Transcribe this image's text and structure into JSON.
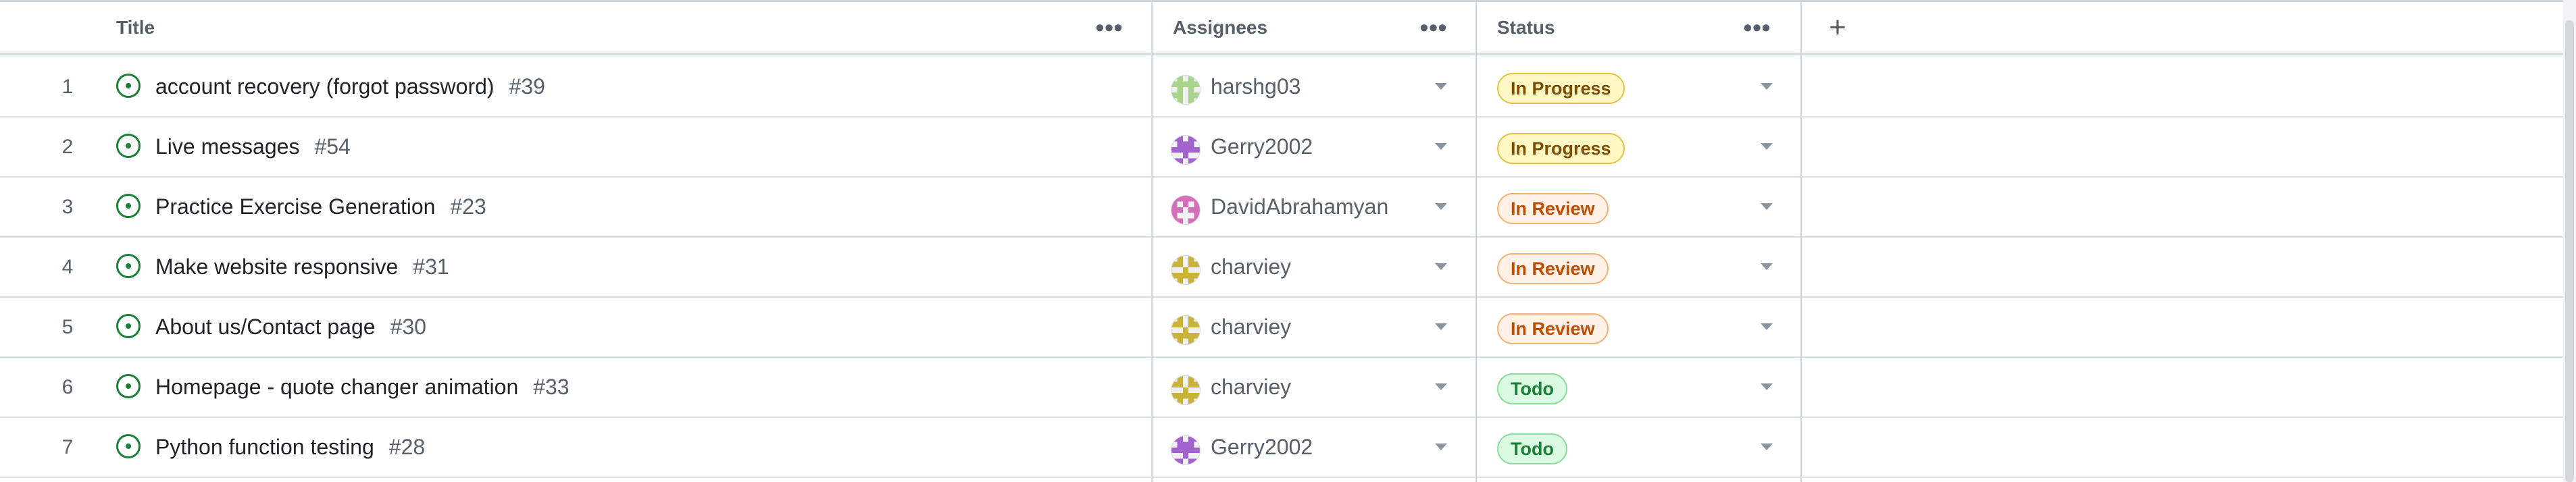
{
  "header": {
    "title_label": "Title",
    "assignees_label": "Assignees",
    "status_label": "Status",
    "menu_glyph": "•••",
    "add_column_glyph": "+"
  },
  "colors": {
    "in_progress": {
      "bg": "#fff8c5",
      "border": "#e3c24a",
      "text": "#7d4e00"
    },
    "in_review": {
      "bg": "#fff1e5",
      "border": "#f2b27a",
      "text": "#bc4c00"
    },
    "todo": {
      "bg": "#dafbe1",
      "border": "#8ddb9f",
      "text": "#1a7f37"
    },
    "open_issue_icon": "#1a7f37"
  },
  "rows": [
    {
      "num": "1",
      "title": "account recovery (forgot password)",
      "issue": "#39",
      "assignee": "harshg03",
      "avatar": "harshg03-avatar",
      "status": "In Progress",
      "status_key": "in_progress"
    },
    {
      "num": "2",
      "title": "Live messages",
      "issue": "#54",
      "assignee": "Gerry2002",
      "avatar": "gerry2002-avatar",
      "status": "In Progress",
      "status_key": "in_progress"
    },
    {
      "num": "3",
      "title": "Practice Exercise Generation",
      "issue": "#23",
      "assignee": "DavidAbrahamyan",
      "avatar": "davidabrahamyan-avatar",
      "status": "In Review",
      "status_key": "in_review"
    },
    {
      "num": "4",
      "title": "Make website responsive",
      "issue": "#31",
      "assignee": "charviey",
      "avatar": "charviey-avatar",
      "status": "In Review",
      "status_key": "in_review"
    },
    {
      "num": "5",
      "title": "About us/Contact page",
      "issue": "#30",
      "assignee": "charviey",
      "avatar": "charviey-avatar",
      "status": "In Review",
      "status_key": "in_review"
    },
    {
      "num": "6",
      "title": "Homepage - quote changer animation",
      "issue": "#33",
      "assignee": "charviey",
      "avatar": "charviey-avatar",
      "status": "Todo",
      "status_key": "todo"
    },
    {
      "num": "7",
      "title": "Python function testing",
      "issue": "#28",
      "assignee": "Gerry2002",
      "avatar": "gerry2002-avatar",
      "status": "Todo",
      "status_key": "todo"
    }
  ]
}
